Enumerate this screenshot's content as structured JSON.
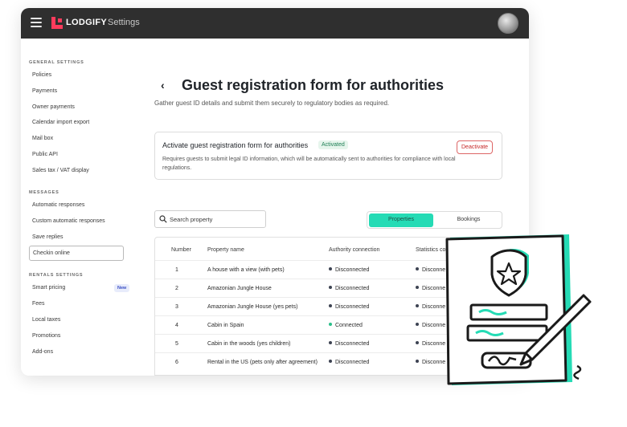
{
  "topbar": {
    "brand": "LODGIFY",
    "title": "Settings"
  },
  "sidebar": {
    "general_heading": "GENERAL SETTINGS",
    "general_items": [
      "Policies",
      "Payments",
      "Owner payments",
      "Calendar import export",
      "Mail box",
      "Public API",
      "Sales tax / VAT display"
    ],
    "messages_heading": "MESSAGES",
    "messages_items": [
      "Automatic responses",
      "Custom automatic responses",
      "Save replies"
    ],
    "selected_item": "Checkin online",
    "rentals_heading": "RENTALS SETTINGS",
    "rentals_items": [
      "Smart pricing",
      "Fees",
      "Local taxes",
      "Promotions",
      "Add-ons"
    ],
    "new_badge": "New"
  },
  "page": {
    "title": "Guest registration form for authorities",
    "subtitle": "Gather guest ID details and submit them securely to regulatory bodies as required."
  },
  "card": {
    "title": "Activate guest registration form for authorities",
    "badge": "Activated",
    "description": "Requires guests to submit legal ID information, which will be automatically sent to authorities for compliance with local regulations.",
    "button": "Deactivate"
  },
  "search": {
    "placeholder": "Search property"
  },
  "segmented": {
    "active": "Properties",
    "inactive": "Bookings"
  },
  "table": {
    "headers": [
      "Number",
      "Property name",
      "Authority connection",
      "Statistics conn"
    ],
    "rows": [
      {
        "number": "1",
        "name": "A house with a view (with pets)",
        "authority": "Disconnected",
        "statistics": "Disconne"
      },
      {
        "number": "2",
        "name": "Amazonian Jungle House",
        "authority": "Disconnected",
        "statistics": "Disconne"
      },
      {
        "number": "3",
        "name": "Amazonian Jungle House (yes pets)",
        "authority": "Disconnected",
        "statistics": "Disconne"
      },
      {
        "number": "4",
        "name": "Cabin in Spain",
        "authority": "Connected",
        "statistics": "Disconne"
      },
      {
        "number": "5",
        "name": "Cabin in the woods (yes children)",
        "authority": "Disconnected",
        "statistics": "Disconne"
      },
      {
        "number": "6",
        "name": "Rental in the US (pets only after agreement)",
        "authority": "Disconnected",
        "statistics": "Disconne"
      }
    ]
  },
  "colors": {
    "accent": "#25dbb5",
    "brand": "#ff3b5c",
    "connected": "#2bbf8a",
    "disconnected": "#3d4352",
    "topbar": "#2f2f2f"
  }
}
